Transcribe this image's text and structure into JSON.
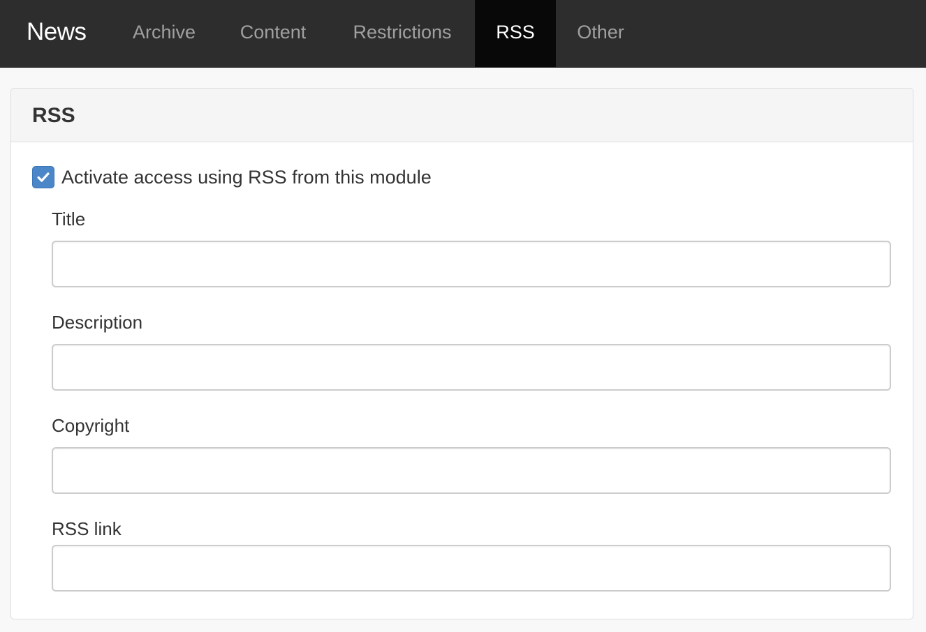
{
  "navbar": {
    "brand": "News",
    "tabs": [
      {
        "label": "Archive",
        "active": false
      },
      {
        "label": "Content",
        "active": false
      },
      {
        "label": "Restrictions",
        "active": false
      },
      {
        "label": "RSS",
        "active": true
      },
      {
        "label": "Other",
        "active": false
      }
    ]
  },
  "panel": {
    "title": "RSS",
    "activate_checkbox": {
      "label": "Activate access using RSS from this module",
      "checked": true,
      "icon": "check-icon"
    },
    "fields": [
      {
        "label": "Title",
        "value": ""
      },
      {
        "label": "Description",
        "value": ""
      },
      {
        "label": "Copyright",
        "value": ""
      },
      {
        "label": "RSS link",
        "value": ""
      }
    ]
  },
  "colors": {
    "navbar_bg": "#2d2d2d",
    "active_tab_bg": "#080808",
    "checkbox_accent": "#4a86c8",
    "page_bg": "#f8f8f8"
  }
}
